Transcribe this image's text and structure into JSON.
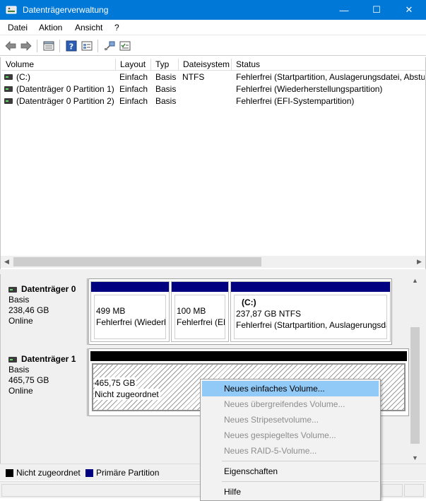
{
  "window": {
    "title": "Datenträgerverwaltung",
    "minimize_glyph": "—",
    "maximize_glyph": "☐",
    "close_glyph": "✕"
  },
  "menu": [
    "Datei",
    "Aktion",
    "Ansicht",
    "?"
  ],
  "toolbar": {
    "icons": [
      "back-icon",
      "forward-icon",
      "list-view-icon",
      "help-icon",
      "properties-icon",
      "connect-icon",
      "settings-icon"
    ]
  },
  "volume_list": {
    "columns": [
      "Volume",
      "Layout",
      "Typ",
      "Dateisystem",
      "Status"
    ],
    "rows": [
      {
        "volume": "(C:)",
        "layout": "Einfach",
        "typ": "Basis",
        "dateisystem": "NTFS",
        "status": "Fehlerfrei (Startpartition, Auslagerungsdatei, Absturzspeicherabbild, Primäre Partition)"
      },
      {
        "volume": "(Datenträger 0 Partition 1)",
        "layout": "Einfach",
        "typ": "Basis",
        "dateisystem": "",
        "status": "Fehlerfrei (Wiederherstellungspartition)"
      },
      {
        "volume": "(Datenträger 0 Partition 2)",
        "layout": "Einfach",
        "typ": "Basis",
        "dateisystem": "",
        "status": "Fehlerfrei (EFI-Systempartition)"
      }
    ]
  },
  "disks": [
    {
      "name": "Datenträger 0",
      "type": "Basis",
      "size": "238,46 GB",
      "state": "Online",
      "partitions": [
        {
          "title": "",
          "size": "499 MB",
          "status": "Fehlerfrei (Wiederherstellungspartition)"
        },
        {
          "title": "",
          "size": "100 MB",
          "status": "Fehlerfrei (EFI-Systempartition)"
        },
        {
          "title": "(C:)",
          "size": "237,87 GB NTFS",
          "status": "Fehlerfrei (Startpartition, Auslagerungsdatei, Absturzspeicherabbild)"
        }
      ]
    },
    {
      "name": "Datenträger 1",
      "type": "Basis",
      "size": "465,75 GB",
      "state": "Online",
      "partitions": [
        {
          "title": "",
          "size": "465,75 GB",
          "status": "Nicht zugeordnet"
        }
      ]
    }
  ],
  "legend": [
    {
      "label": "Nicht zugeordnet",
      "color": "#000000"
    },
    {
      "label": "Primäre Partition",
      "color": "#000080"
    }
  ],
  "context_menu": {
    "items": [
      {
        "label": "Neues einfaches Volume...",
        "enabled": true,
        "highlighted": true
      },
      {
        "label": "Neues übergreifendes Volume...",
        "enabled": false
      },
      {
        "label": "Neues Stripesetvolume...",
        "enabled": false
      },
      {
        "label": "Neues gespiegeltes Volume...",
        "enabled": false
      },
      {
        "label": "Neues RAID-5-Volume...",
        "enabled": false
      },
      {
        "label": "Eigenschaften",
        "enabled": true
      },
      {
        "label": "Hilfe",
        "enabled": true
      }
    ]
  },
  "colors": {
    "titlebar": "#0078d7",
    "primary_partition": "#000080",
    "unallocated": "#000000",
    "menu_highlight": "#91c9f7"
  }
}
